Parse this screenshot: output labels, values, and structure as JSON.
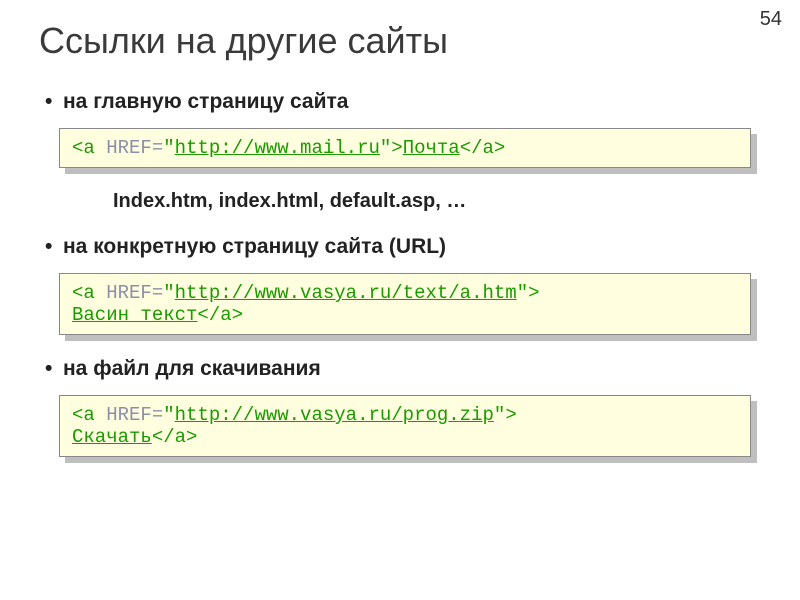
{
  "page_number": "54",
  "title": "Ссылки на другие сайты",
  "sections": {
    "s1": {
      "bullet": "на главную страницу сайта",
      "code": {
        "open1": "<a",
        "attr": " HREF=",
        "q1": "\"",
        "url": "http://www.mail.ru",
        "q2": "\"",
        "open2": ">",
        "linktext": "Почта",
        "close": "</a>"
      },
      "note": "Index.htm, index.html, default.asp, …"
    },
    "s2": {
      "bullet": "на конкретную страницу сайта (URL)",
      "code": {
        "open1": "<a",
        "attr": " HREF=",
        "q1": "\"",
        "url": "http://www.vasya.ru/text/a.htm",
        "q2": "\"",
        "open2": ">",
        "linktext": "Васин текст",
        "close": "</a>"
      }
    },
    "s3": {
      "bullet": "на файл для скачивания",
      "code": {
        "open1": "<a",
        "attr": " HREF=",
        "q1": "\"",
        "url": "http://www.vasya.ru/prog.zip",
        "q2": "\"",
        "open2": ">",
        "linktext": "Скачать",
        "close": "</a>"
      }
    }
  }
}
